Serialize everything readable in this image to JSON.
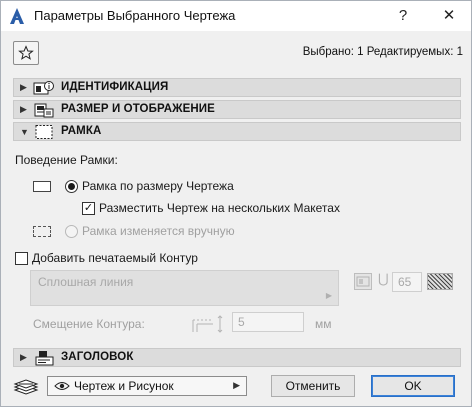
{
  "window": {
    "title": "Параметры Выбранного Чертежа",
    "help_label": "?",
    "close_label": "✕"
  },
  "toolbar": {
    "selection_info": "Выбрано: 1 Редактируемых: 1"
  },
  "panels": {
    "identification": "ИДЕНТИФИКАЦИЯ",
    "size_display": "РАЗМЕР И ОТОБРАЖЕНИЕ",
    "frame": "РАМКА",
    "title": "ЗАГОЛОВОК"
  },
  "frame_section": {
    "behavior_label": "Поведение Рамки:",
    "option_fit": "Рамка по размеру Чертежа",
    "option_fit_selected": true,
    "place_multi_label": "Разместить Чертеж на нескольких Макетах",
    "place_multi_checked": true,
    "option_manual": "Рамка изменяется вручную",
    "add_contour_label": "Добавить печатаемый Контур",
    "add_contour_checked": false,
    "line_type": "Сплошная линия",
    "pen_number": "65",
    "offset_label": "Смещение Контура:",
    "offset_value": "5",
    "offset_unit": "мм"
  },
  "footer": {
    "layer_dropdown_value": "Чертеж и Рисунок",
    "cancel_label": "Отменить",
    "ok_label": "OK"
  }
}
